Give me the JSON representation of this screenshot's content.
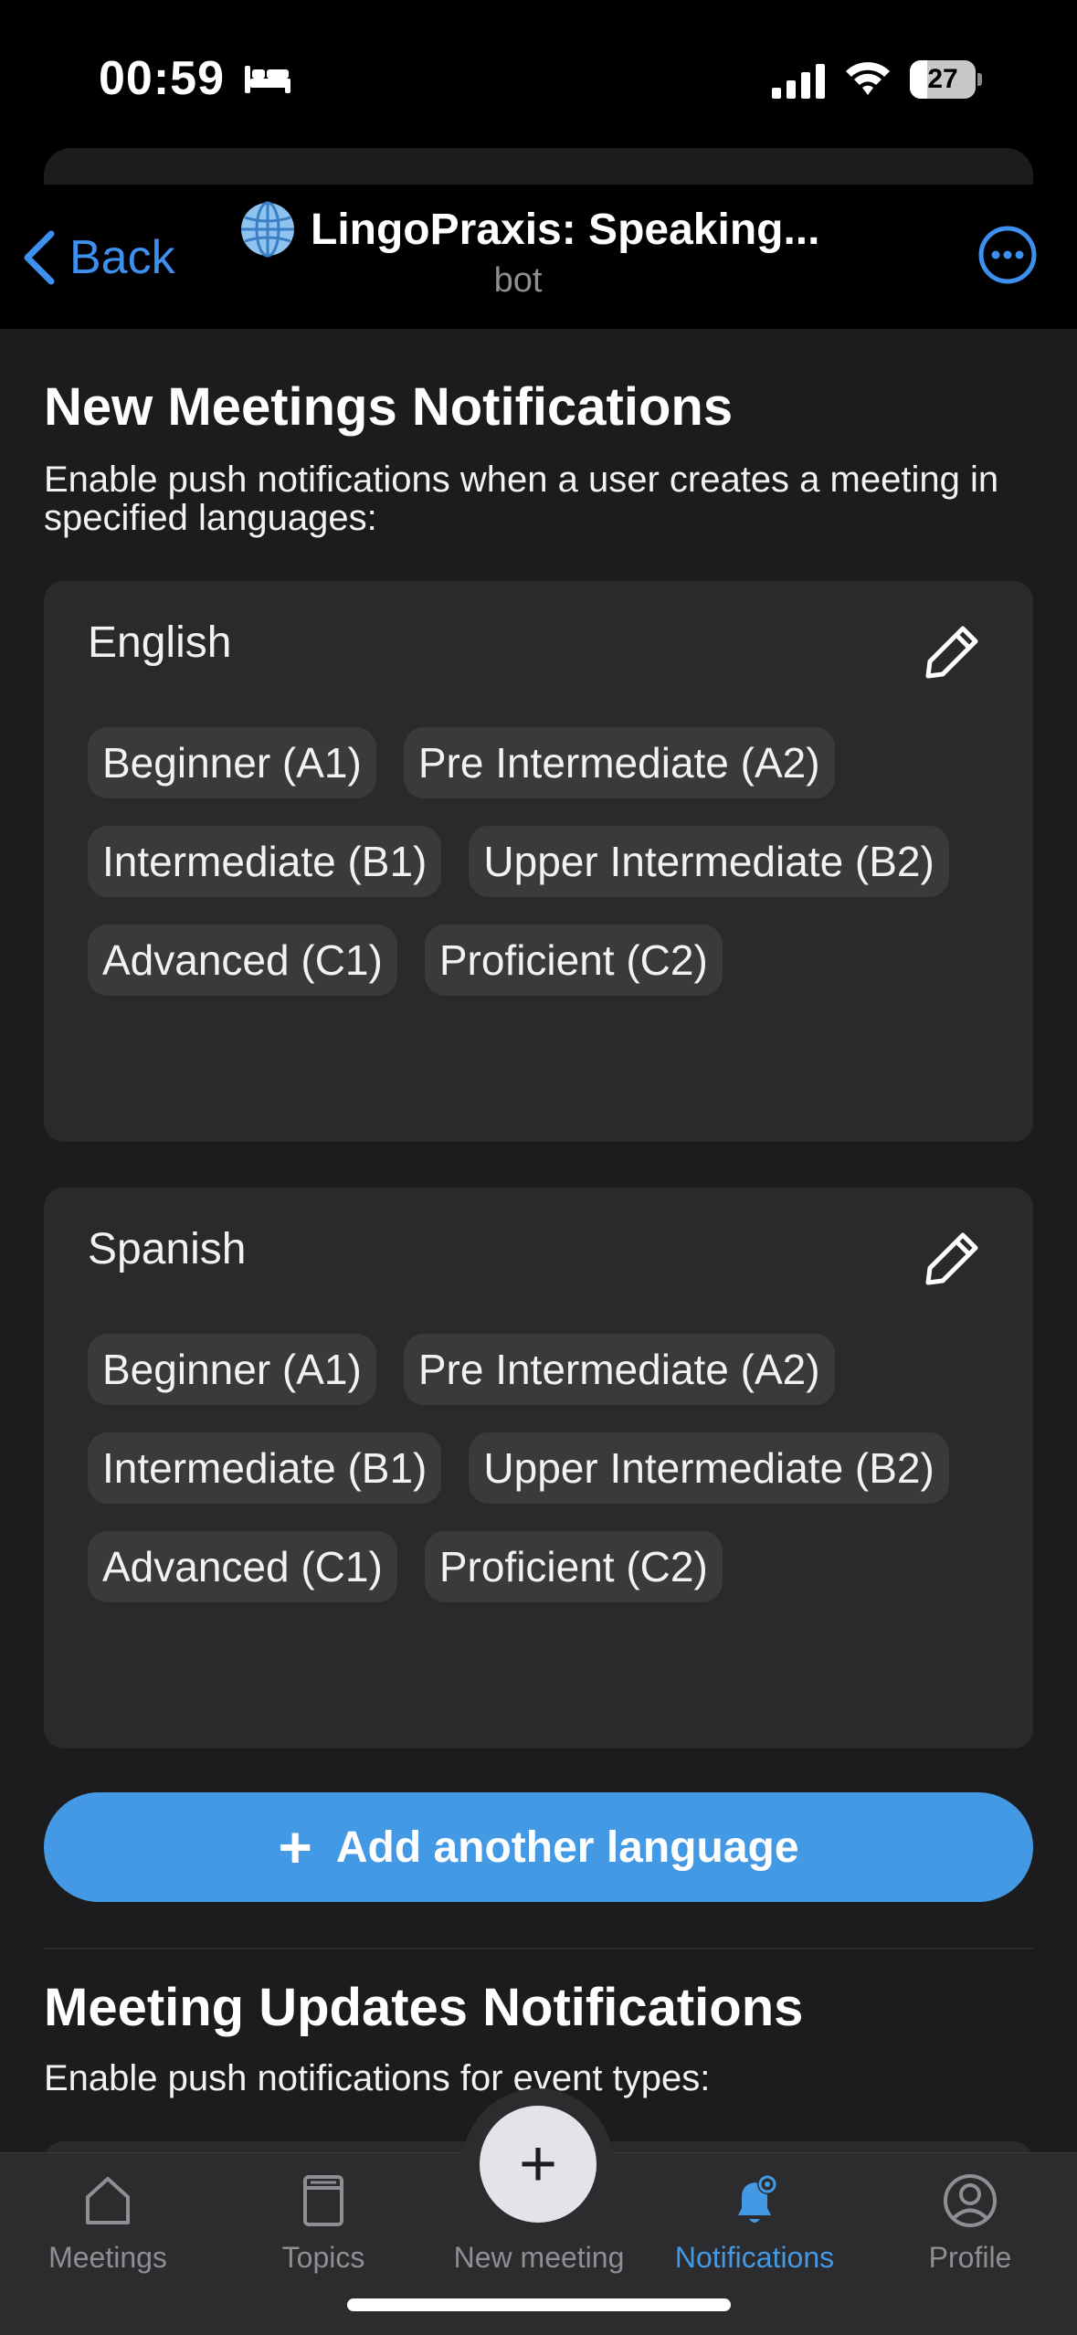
{
  "status_bar": {
    "time": "00:59",
    "battery": "27",
    "battery_level": 0.27
  },
  "header": {
    "back_label": "Back",
    "title": "LingoPraxis: Speaking...",
    "subtitle": "bot"
  },
  "new_meetings": {
    "title": "New Meetings Notifications",
    "description": "Enable push notifications when a user creates a meeting in specified languages:",
    "languages": [
      {
        "name": "English",
        "levels": [
          "Beginner (A1)",
          "Pre Intermediate (A2)",
          "Intermediate (B1)",
          "Upper Intermediate (B2)",
          "Advanced (C1)",
          "Proficient (C2)"
        ]
      },
      {
        "name": "Spanish",
        "levels": [
          "Beginner (A1)",
          "Pre Intermediate (A2)",
          "Intermediate (B1)",
          "Upper Intermediate (B2)",
          "Advanced (C1)",
          "Proficient (C2)"
        ]
      }
    ],
    "add_button": {
      "plus": "+",
      "label": "Add another language"
    }
  },
  "meeting_updates": {
    "title": "Meeting Updates Notifications",
    "description": "Enable push notifications for event types:"
  },
  "tabbar": {
    "fab_plus": "+",
    "tabs": [
      {
        "label": "Meetings",
        "icon": "home-icon"
      },
      {
        "label": "Topics",
        "icon": "book-icon"
      },
      {
        "label": "New meeting",
        "icon": "plus-icon"
      },
      {
        "label": "Notifications",
        "icon": "bell-gear-icon",
        "active": true
      },
      {
        "label": "Profile",
        "icon": "user-circle-icon"
      }
    ]
  },
  "colors": {
    "accent": "#4499e4",
    "link": "#3d8ff0",
    "card": "#2a2a2c",
    "chip": "#3a3a3c",
    "background": "#1c1c1e"
  }
}
